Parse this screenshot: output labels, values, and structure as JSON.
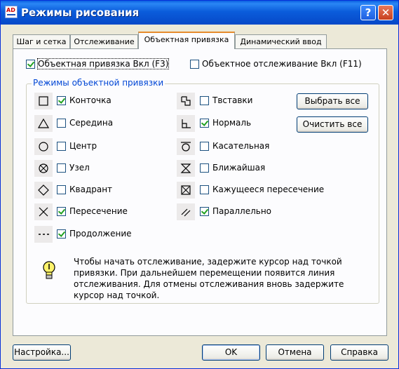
{
  "window": {
    "title": "Режимы рисования",
    "help_label": "?",
    "close_label": "✕",
    "app_icon_text": "AD",
    "app_icon": "autocad-app-icon"
  },
  "tabs": [
    {
      "label": "Шаг и сетка"
    },
    {
      "label": "Отслеживание"
    },
    {
      "label": "Объектная привязка",
      "active": true
    },
    {
      "label": "Динамический ввод"
    }
  ],
  "osnap_on": {
    "label": "Объектная привязка Вкл (F3)",
    "checked": true
  },
  "otrack_on": {
    "label": "Объектное отслеживание Вкл (F11)",
    "checked": false
  },
  "modes_group": {
    "title": "Режимы объектной привязки"
  },
  "modes_left": [
    {
      "label": "Конточка",
      "checked": true,
      "icon": "endpoint-icon"
    },
    {
      "label": "Середина",
      "checked": false,
      "icon": "midpoint-icon"
    },
    {
      "label": "Центр",
      "checked": false,
      "icon": "center-icon"
    },
    {
      "label": "Узел",
      "checked": false,
      "icon": "node-icon"
    },
    {
      "label": "Квадрант",
      "checked": false,
      "icon": "quadrant-icon"
    },
    {
      "label": "Пересечение",
      "checked": true,
      "icon": "intersection-icon"
    },
    {
      "label": "Продолжение",
      "checked": true,
      "icon": "extension-icon"
    }
  ],
  "modes_right": [
    {
      "label": "Твставки",
      "checked": false,
      "icon": "insertion-icon"
    },
    {
      "label": "Нормаль",
      "checked": true,
      "icon": "perpendicular-icon"
    },
    {
      "label": "Касательная",
      "checked": false,
      "icon": "tangent-icon"
    },
    {
      "label": "Ближайшая",
      "checked": false,
      "icon": "nearest-icon"
    },
    {
      "label": "Кажущееся пересечение",
      "checked": false,
      "icon": "apparent-intersection-icon"
    },
    {
      "label": "Параллельно",
      "checked": true,
      "icon": "parallel-icon"
    }
  ],
  "select_all_label": "Выбрать все",
  "clear_all_label": "Очистить все",
  "hint": {
    "icon": "lightbulb-icon",
    "text": "Чтобы начать отслеживание, задержите курсор над точкой привязки. При дальнейшем перемещении появится линия отслеживания. Для отмены отслеживания вновь задержите курсор над точкой."
  },
  "footer": {
    "settings_label": "Настройка...",
    "ok_label": "OK",
    "cancel_label": "Отмена",
    "help_label": "Справка"
  }
}
